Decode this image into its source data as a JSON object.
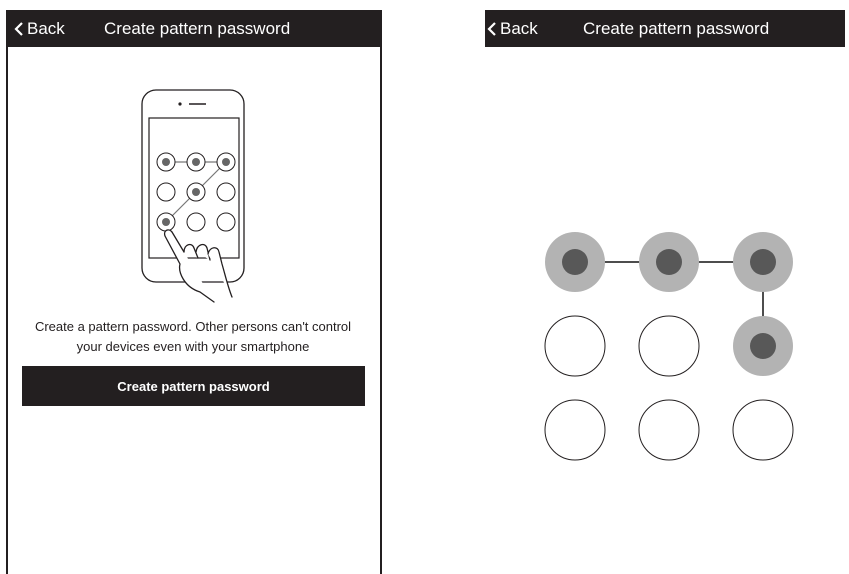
{
  "left_screen": {
    "header": {
      "back_label": "Back",
      "title": "Create pattern password"
    },
    "description_line1": "Create a pattern password. Other persons can't control",
    "description_line2": "your devices even with your smartphone",
    "create_button_label": "Create pattern password"
  },
  "right_screen": {
    "header": {
      "back_label": "Back",
      "title": "Create pattern password"
    },
    "pattern_grid": {
      "selected_dots": [
        1,
        2,
        3,
        6
      ],
      "colors": {
        "outer": "#b3b3b3",
        "inner": "#585858",
        "line": "#4d4d4d",
        "empty_stroke": "#231f20"
      }
    }
  },
  "colors": {
    "header_bg": "#231f20",
    "header_text": "#ffffff",
    "button_bg": "#231f20"
  },
  "icons": {
    "back": "chevron-left-icon",
    "hand": "hand-pointer-icon",
    "phone": "smartphone-icon"
  }
}
